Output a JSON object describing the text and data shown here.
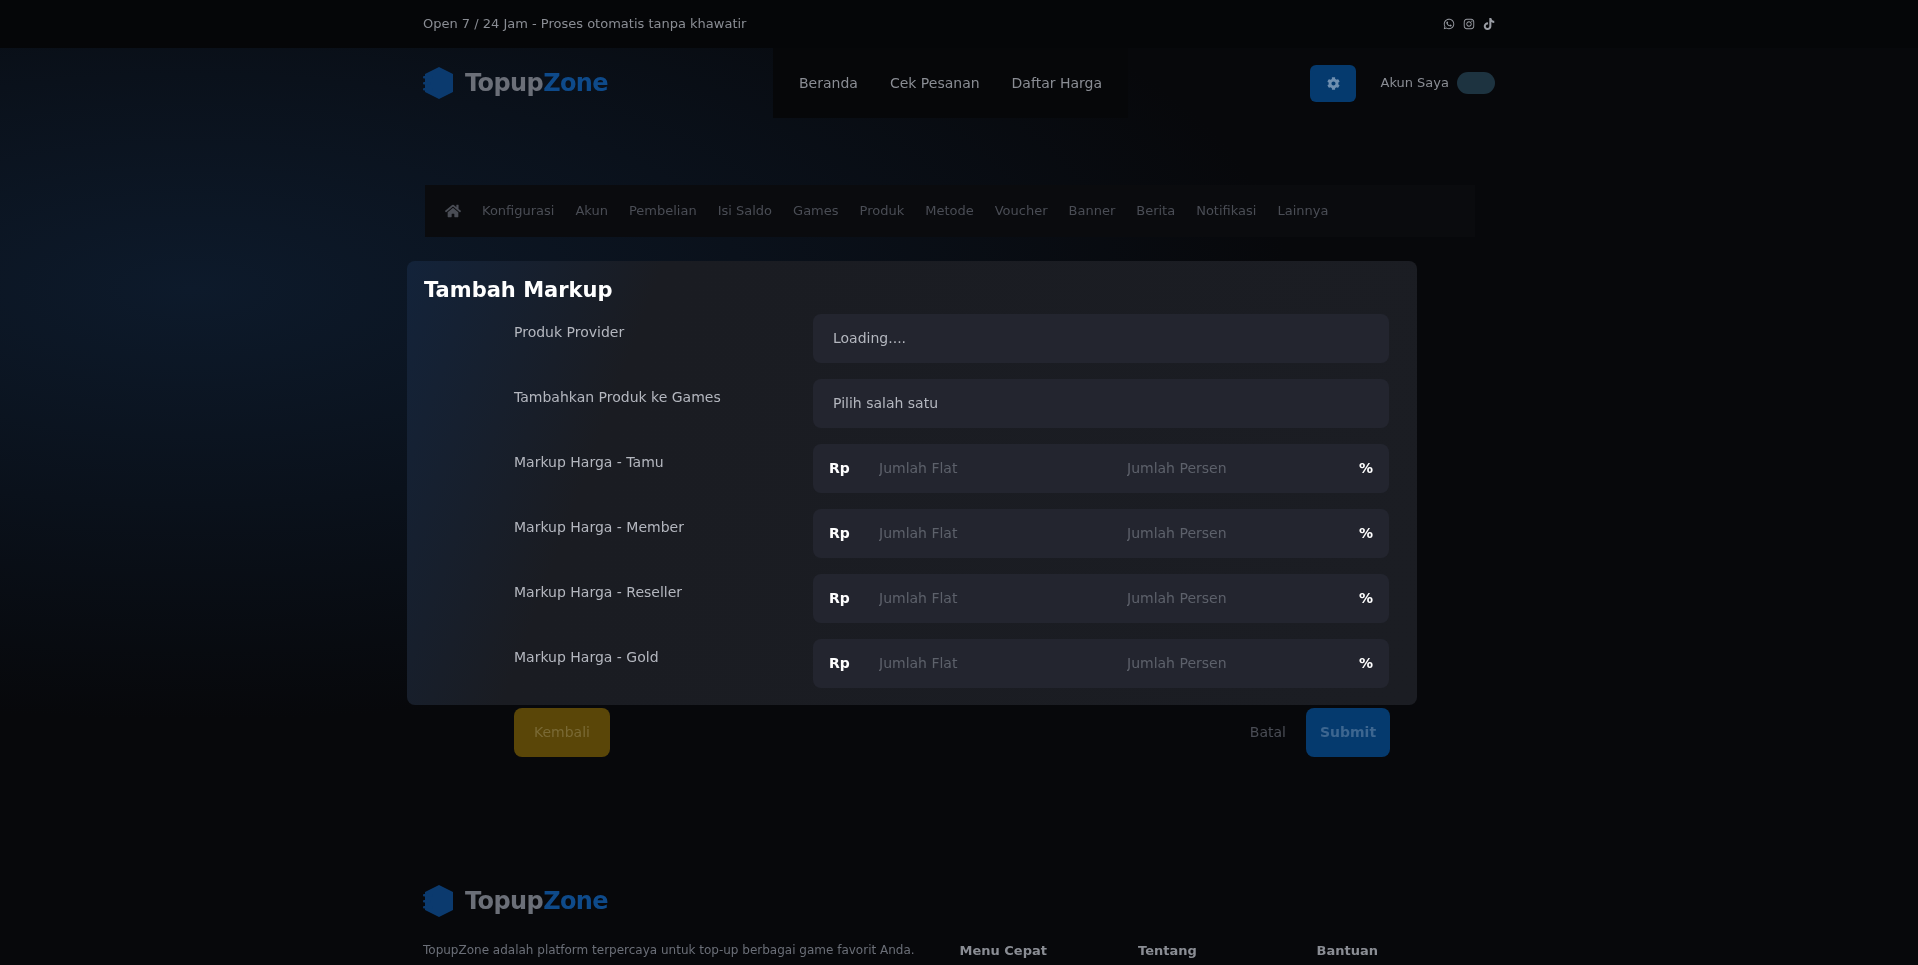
{
  "topbar": {
    "text": "Open 7 / 24 Jam - Proses otomatis tanpa khawatir"
  },
  "header": {
    "logo": [
      "Topup",
      "Zone"
    ],
    "nav": [
      "Beranda",
      "Cek Pesanan",
      "Daftar Harga"
    ],
    "account": "Akun Saya"
  },
  "admin_menu": [
    "Konfigurasi",
    "Akun",
    "Pembelian",
    "Isi Saldo",
    "Games",
    "Produk",
    "Metode",
    "Voucher",
    "Banner",
    "Berita",
    "Notifikasi",
    "Lainnya"
  ],
  "modal": {
    "title": "Tambah Markup",
    "fields": [
      {
        "kind": "select",
        "label": "Produk Provider",
        "value": "Loading...."
      },
      {
        "kind": "select",
        "label": "Tambahkan Produk ke Games",
        "value": "Pilih salah satu"
      },
      {
        "kind": "markup",
        "label": "Markup Harga - Tamu",
        "prefix": "Rp",
        "flat_placeholder": "Jumlah Flat",
        "percent_placeholder": "Jumlah Persen",
        "suffix": "%"
      },
      {
        "kind": "markup",
        "label": "Markup Harga - Member",
        "prefix": "Rp",
        "flat_placeholder": "Jumlah Flat",
        "percent_placeholder": "Jumlah Persen",
        "suffix": "%"
      },
      {
        "kind": "markup",
        "label": "Markup Harga - Reseller",
        "prefix": "Rp",
        "flat_placeholder": "Jumlah Flat",
        "percent_placeholder": "Jumlah Persen",
        "suffix": "%"
      },
      {
        "kind": "markup",
        "label": "Markup Harga - Gold",
        "prefix": "Rp",
        "flat_placeholder": "Jumlah Flat",
        "percent_placeholder": "Jumlah Persen",
        "suffix": "%"
      }
    ]
  },
  "actions": {
    "back": "Kembali",
    "cancel": "Batal",
    "submit": "Submit"
  },
  "footer": {
    "logo": [
      "Topup",
      "Zone"
    ],
    "description": "TopupZone adalah platform terpercaya untuk top-up berbagai game favorit Anda.",
    "columns": [
      "Menu Cepat",
      "Tentang",
      "Bantuan"
    ]
  }
}
